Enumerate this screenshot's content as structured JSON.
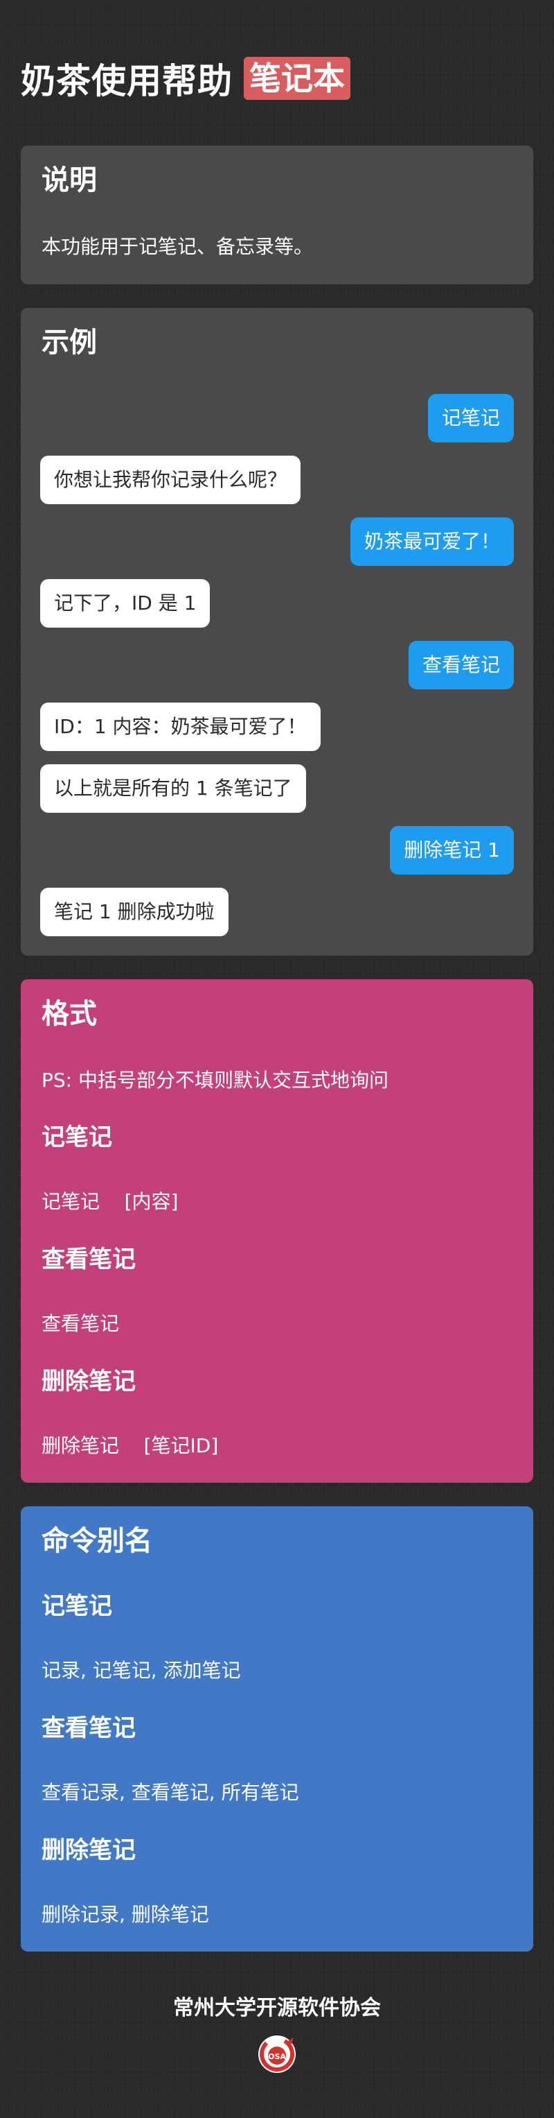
{
  "header": {
    "title": "奶茶使用帮助",
    "tag": "笔记本"
  },
  "description": {
    "title": "说明",
    "text": "本功能用于记笔记、备忘录等。"
  },
  "example": {
    "title": "示例",
    "messages": [
      {
        "role": "user",
        "text": "记笔记"
      },
      {
        "role": "bot",
        "text": "你想让我帮你记录什么呢？"
      },
      {
        "role": "user",
        "text": "奶茶最可爱了！"
      },
      {
        "role": "bot",
        "text": "记下了，ID 是 1"
      },
      {
        "role": "user",
        "text": "查看笔记"
      },
      {
        "role": "bot",
        "text": "ID：1 内容：奶茶最可爱了！"
      },
      {
        "role": "bot",
        "text": "以上就是所有的 1 条笔记了"
      },
      {
        "role": "user",
        "text": "删除笔记 1"
      },
      {
        "role": "bot",
        "text": "笔记 1 删除成功啦"
      }
    ]
  },
  "format": {
    "title": "格式",
    "note": "PS: 中括号部分不填则默认交互式地询问",
    "items": [
      {
        "name": "记笔记",
        "usage": "记笔记    [内容]"
      },
      {
        "name": "查看笔记",
        "usage": "查看笔记"
      },
      {
        "name": "删除笔记",
        "usage": "删除笔记    [笔记ID]"
      }
    ]
  },
  "aliases": {
    "title": "命令别名",
    "items": [
      {
        "name": "记笔记",
        "aliases": "记录, 记笔记, 添加笔记"
      },
      {
        "name": "查看笔记",
        "aliases": "查看记录, 查看笔记, 所有笔记"
      },
      {
        "name": "删除笔记",
        "aliases": "删除记录, 删除笔记"
      }
    ]
  },
  "footer": {
    "text": "常州大学开源软件协会",
    "logo_text": "OSA"
  },
  "colors": {
    "background": "#2a2a2a",
    "card_gray": "#4a4a4a",
    "card_pink": "#c4407b",
    "card_blue": "#4279c6",
    "tag_red": "#d95c5e",
    "bubble_user": "#1e9df0",
    "bubble_bot": "#ffffff"
  }
}
